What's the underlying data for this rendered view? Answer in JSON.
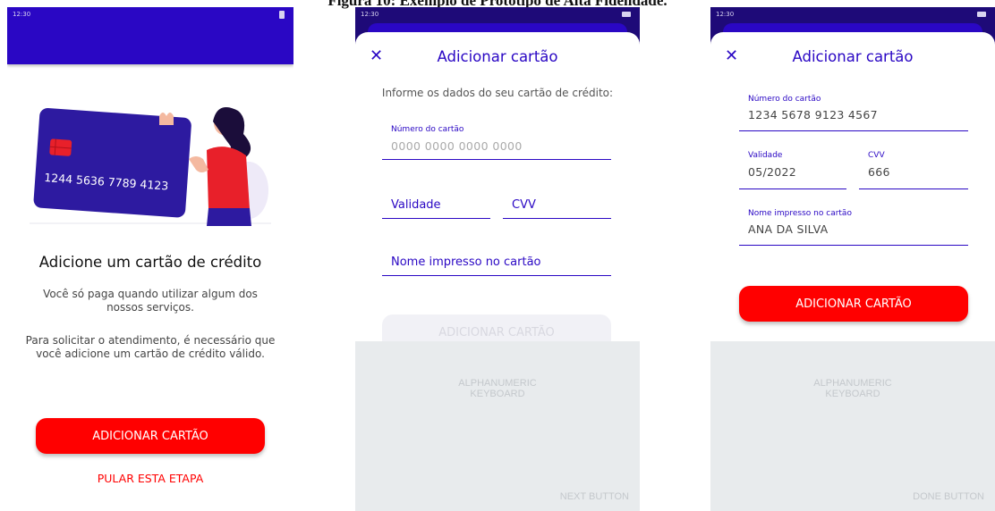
{
  "caption": "Figura 10: Exemplo de Protótipo de Alta Fidelidade.",
  "status_time": "12:30",
  "screen1": {
    "card_number": "1244 5636 7789 4123",
    "title": "Adicione um cartão de crédito",
    "paragraph1": "Você só paga quando utilizar algum dos nossos serviços.",
    "paragraph2": "Para solicitar o atendimento, é necessário que você adicione um cartão de crédito válido.",
    "add_button": "ADICIONAR CARTÃO",
    "skip_link": "PULAR ESTA ETAPA"
  },
  "screen2": {
    "title": "Adicionar cartão",
    "instruction": "Informe os dados do seu cartão de crédito:",
    "card_number_label": "Número do cartão",
    "card_number_placeholder": "0000 0000 0000 0000",
    "validity_label": "Validade",
    "cvv_label": "CVV",
    "name_label": "Nome impresso no cartão",
    "add_button": "ADICIONAR CARTÃO",
    "keyboard_label": "ALPHANUMERIC KEYBOARD",
    "keyboard_button": "NEXT BUTTON"
  },
  "screen3": {
    "title": "Adicionar cartão",
    "card_number_label": "Número do cartão",
    "card_number_value": "1234 5678 9123 4567",
    "validity_label": "Validade",
    "validity_value": "05/2022",
    "cvv_label": "CVV",
    "cvv_value": "666",
    "name_label": "Nome impresso no cartão",
    "name_value": "ANA DA SILVA",
    "add_button": "ADICIONAR CARTÃO",
    "keyboard_label": "ALPHANUMERIC KEYBOARD",
    "keyboard_button": "DONE BUTTON"
  },
  "colors": {
    "primary": "#2a07c4",
    "accent_red": "#ff0000",
    "keyboard_bg": "#e8ebed"
  }
}
